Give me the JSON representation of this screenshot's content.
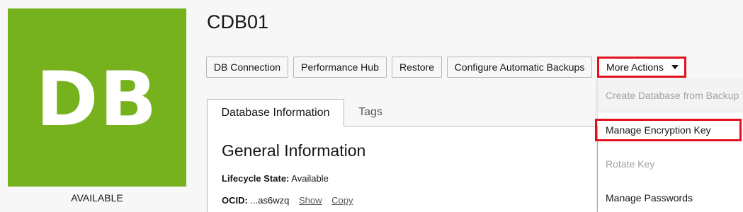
{
  "db_tile": {
    "initials": "DB",
    "status": "AVAILABLE",
    "color": "#76b21e"
  },
  "page": {
    "title": "CDB01"
  },
  "actions": {
    "db_connection": "DB Connection",
    "performance_hub": "Performance Hub",
    "restore": "Restore",
    "configure_backups": "Configure Automatic Backups",
    "more_actions": "More Actions"
  },
  "tabs": [
    {
      "label": "Database Information",
      "active": true
    },
    {
      "label": "Tags",
      "active": false
    }
  ],
  "general_information": {
    "title": "General Information",
    "lifecycle_label": "Lifecycle State:",
    "lifecycle_value": "Available",
    "ocid_label": "OCID:",
    "ocid_value": "...as6wzq",
    "show_link": "Show",
    "copy_link": "Copy"
  },
  "more_actions_menu": {
    "items": [
      {
        "label": "Create Database from Backup",
        "enabled": false
      },
      {
        "label": "Manage Encryption Key",
        "enabled": true,
        "highlighted": true
      },
      {
        "label": "Rotate Key",
        "enabled": false
      },
      {
        "label": "Manage Passwords",
        "enabled": true
      }
    ]
  },
  "colors": {
    "highlight": "#e3101e",
    "db_green": "#76b21e"
  }
}
